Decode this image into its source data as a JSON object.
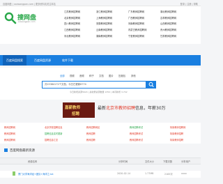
{
  "top_strip": {
    "left_text": "百度网盘 | xxxwangpan.com | 更多资料请关注本站",
    "right_text": "登录 | 注册 | 帮助"
  },
  "logo": {
    "name": "搜网盘",
    "sub": "sowangpan.com"
  },
  "header_links": [
    [
      "江苏教师招聘网",
      "北京教师招聘网",
      "四川教师招聘网",
      "江西教师招聘网",
      "河北教师招聘网"
    ],
    [
      "浙江教师招聘网",
      "上海教师招聘网",
      "安徽教师招聘网",
      "云南教师招聘网",
      "湖南教师招聘网"
    ],
    [
      "广东教师招聘网",
      "广西教师招聘网",
      "河南教师招聘网",
      "内蒙古教师招聘网",
      "宁夏教师招聘网"
    ],
    [
      "湖北教师招聘网",
      "吉林教师招聘网",
      "山西教师招聘网",
      "贵州教师招聘网",
      "甘肃教师招聘网"
    ],
    [
      "辽宁教师招聘网",
      "福建教师招聘网",
      "天津教师招聘网",
      "重庆教师招聘网",
      "青海教师招聘网"
    ]
  ],
  "nav": {
    "items": [
      "百度网盘搜索",
      "百度网盘资源",
      "软件下载"
    ]
  },
  "search": {
    "tabs": [
      "全部",
      "视频",
      "音频",
      "种子",
      "文档",
      "图片",
      "压缩包",
      "其他"
    ],
    "query": "共15384172个文档，今日已更新6774",
    "hint": "今日新增资源5624 | 总收录资源数量 1352 | 本月新增 3,742"
  },
  "banner": {
    "img_line1": "嘉薪教师",
    "img_line2": "招聘",
    "text_pre": "最新",
    "text_hl": "北京市教师招聘",
    "text_post": "信息，年薪30万"
  },
  "links_panel": {
    "col1": [
      "教师招聘网",
      "教师招聘网",
      "教师招聘网"
    ],
    "col2": [
      "北京学校招聘信息",
      "招聘信息实时更新",
      "招聘信息汇总"
    ],
    "col3": [
      "教师招聘网站",
      "教师招聘",
      "教师招聘"
    ],
    "col4": [
      "教师招聘考试",
      "教师招聘考试",
      "教师招聘考试"
    ],
    "col5": [
      "特岗教师招聘网",
      "特岗教师招聘",
      "特岗教师招聘"
    ]
  },
  "recent": {
    "title": "百度网盘最新资源",
    "headers": [
      "资源名称",
      "分享时间",
      "文件大小",
      "下载次数",
      "分享用户"
    ],
    "row": {
      "name": "厦门大学海洋经+团队+海洋之.txt",
      "time": "2020-02-14",
      "size": "1.77MB",
      "downloads": "2183次",
      "user": "xxxx"
    }
  },
  "colors": {
    "brand": "#1a7fe0",
    "logo": "#2aa84a",
    "accent": "#e23b2a"
  }
}
